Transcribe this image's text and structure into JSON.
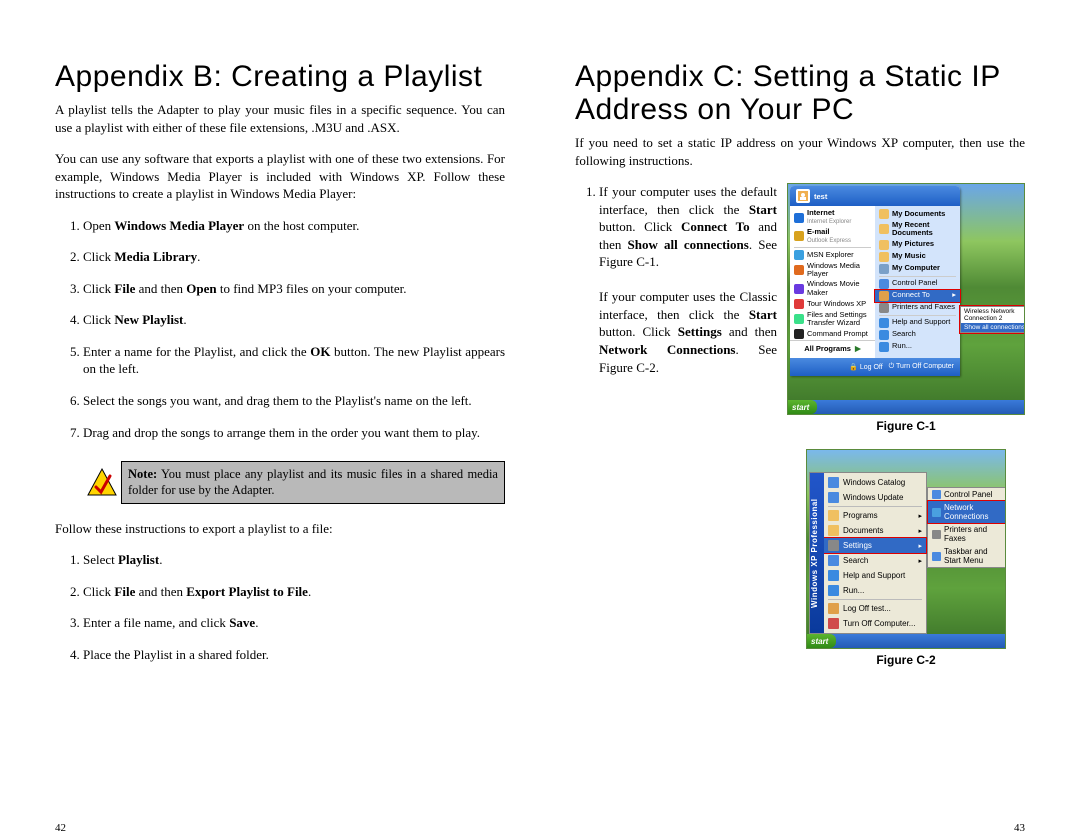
{
  "left": {
    "title": "Appendix B: Creating a Playlist",
    "intro1": "A playlist tells the Adapter to play your music files in a specific sequence. You can use a playlist with either of these file extensions, .M3U and .ASX.",
    "intro2": "You can use any software that exports a playlist with one of these two extensions. For example, Windows Media Player is included with Windows XP. Follow these instructions to create a playlist in Windows Media Player:",
    "steps1": {
      "s1a": "Open ",
      "s1b": "Windows Media Player",
      "s1c": " on the host computer.",
      "s2a": "Click ",
      "s2b": "Media Library",
      "s2c": ".",
      "s3a": "Click ",
      "s3b": "File",
      "s3c": " and then ",
      "s3d": "Open",
      "s3e": " to find MP3 files on your computer.",
      "s4a": "Click ",
      "s4b": "New Playlist",
      "s4c": ".",
      "s5a": "Enter a name for the Playlist, and click the ",
      "s5b": "OK",
      "s5c": " button. The new Playlist appears on the left.",
      "s6": "Select the songs you want, and drag them to the Playlist's name on the left.",
      "s7": "Drag and drop the songs to arrange them in the order you want them to play."
    },
    "note": {
      "label": "Note:",
      "text": " You must place any playlist and its music files in a shared media folder for use by the Adapter."
    },
    "export_intro": "Follow these instructions to export a playlist to a file:",
    "steps2": {
      "s1a": "Select ",
      "s1b": "Playlist",
      "s1c": ".",
      "s2a": "Click ",
      "s2b": "File",
      "s2c": " and then ",
      "s2d": "Export Playlist to File",
      "s2e": ".",
      "s3a": "Enter a file name, and click ",
      "s3b": "Save",
      "s3c": ".",
      "s4": "Place the Playlist in a shared folder."
    },
    "pagenum": "42"
  },
  "right": {
    "title": "Appendix C: Setting a Static IP Address on Your PC",
    "intro": "If you need to set a static IP address on your Windows XP computer, then use the following instructions.",
    "step1": {
      "p1a": "If your computer uses the default interface, then click the ",
      "p1b": "Start",
      "p1c": " button. Click ",
      "p1d": "Connect To",
      "p1e": " and then ",
      "p1f": "Show all connections",
      "p1g": ". See Figure C-1.",
      "p2a": "If your computer uses the Classic interface, then click the ",
      "p2b": "Start",
      "p2c": " button. Click ",
      "p2d": "Settings",
      "p2e": " and then ",
      "p2f": "Network Connections",
      "p2g": ". See Figure C-2."
    },
    "fig1": {
      "caption": "Figure C-1",
      "user": "test",
      "left_items": [
        "Internet",
        "E-mail",
        "MSN Explorer",
        "Windows Media Player",
        "Windows Movie Maker",
        "Tour Windows XP",
        "Files and Settings Transfer Wizard",
        "Command Prompt"
      ],
      "left_sub": [
        "Internet Explorer",
        "Outlook Express"
      ],
      "right_items": [
        "My Documents",
        "My Recent Documents",
        "My Pictures",
        "My Music",
        "My Computer",
        "Control Panel",
        "Connect To",
        "Printers and Faxes",
        "Help and Support",
        "Search",
        "Run..."
      ],
      "allprogs": "All Programs",
      "footer": [
        "Log Off",
        "Turn Off Computer"
      ],
      "flyout": [
        "Wireless Network Connection 2",
        "Show all connections"
      ],
      "start": "start"
    },
    "fig2": {
      "caption": "Figure C-2",
      "strip": "Windows XP Professional",
      "items": [
        "Windows Catalog",
        "Windows Update",
        "Programs",
        "Documents",
        "Settings",
        "Search",
        "Help and Support",
        "Run...",
        "Log Off test...",
        "Turn Off Computer..."
      ],
      "flyout": [
        "Control Panel",
        "Network Connections",
        "Printers and Faxes",
        "Taskbar and Start Menu"
      ],
      "start": "start"
    },
    "pagenum": "43"
  }
}
